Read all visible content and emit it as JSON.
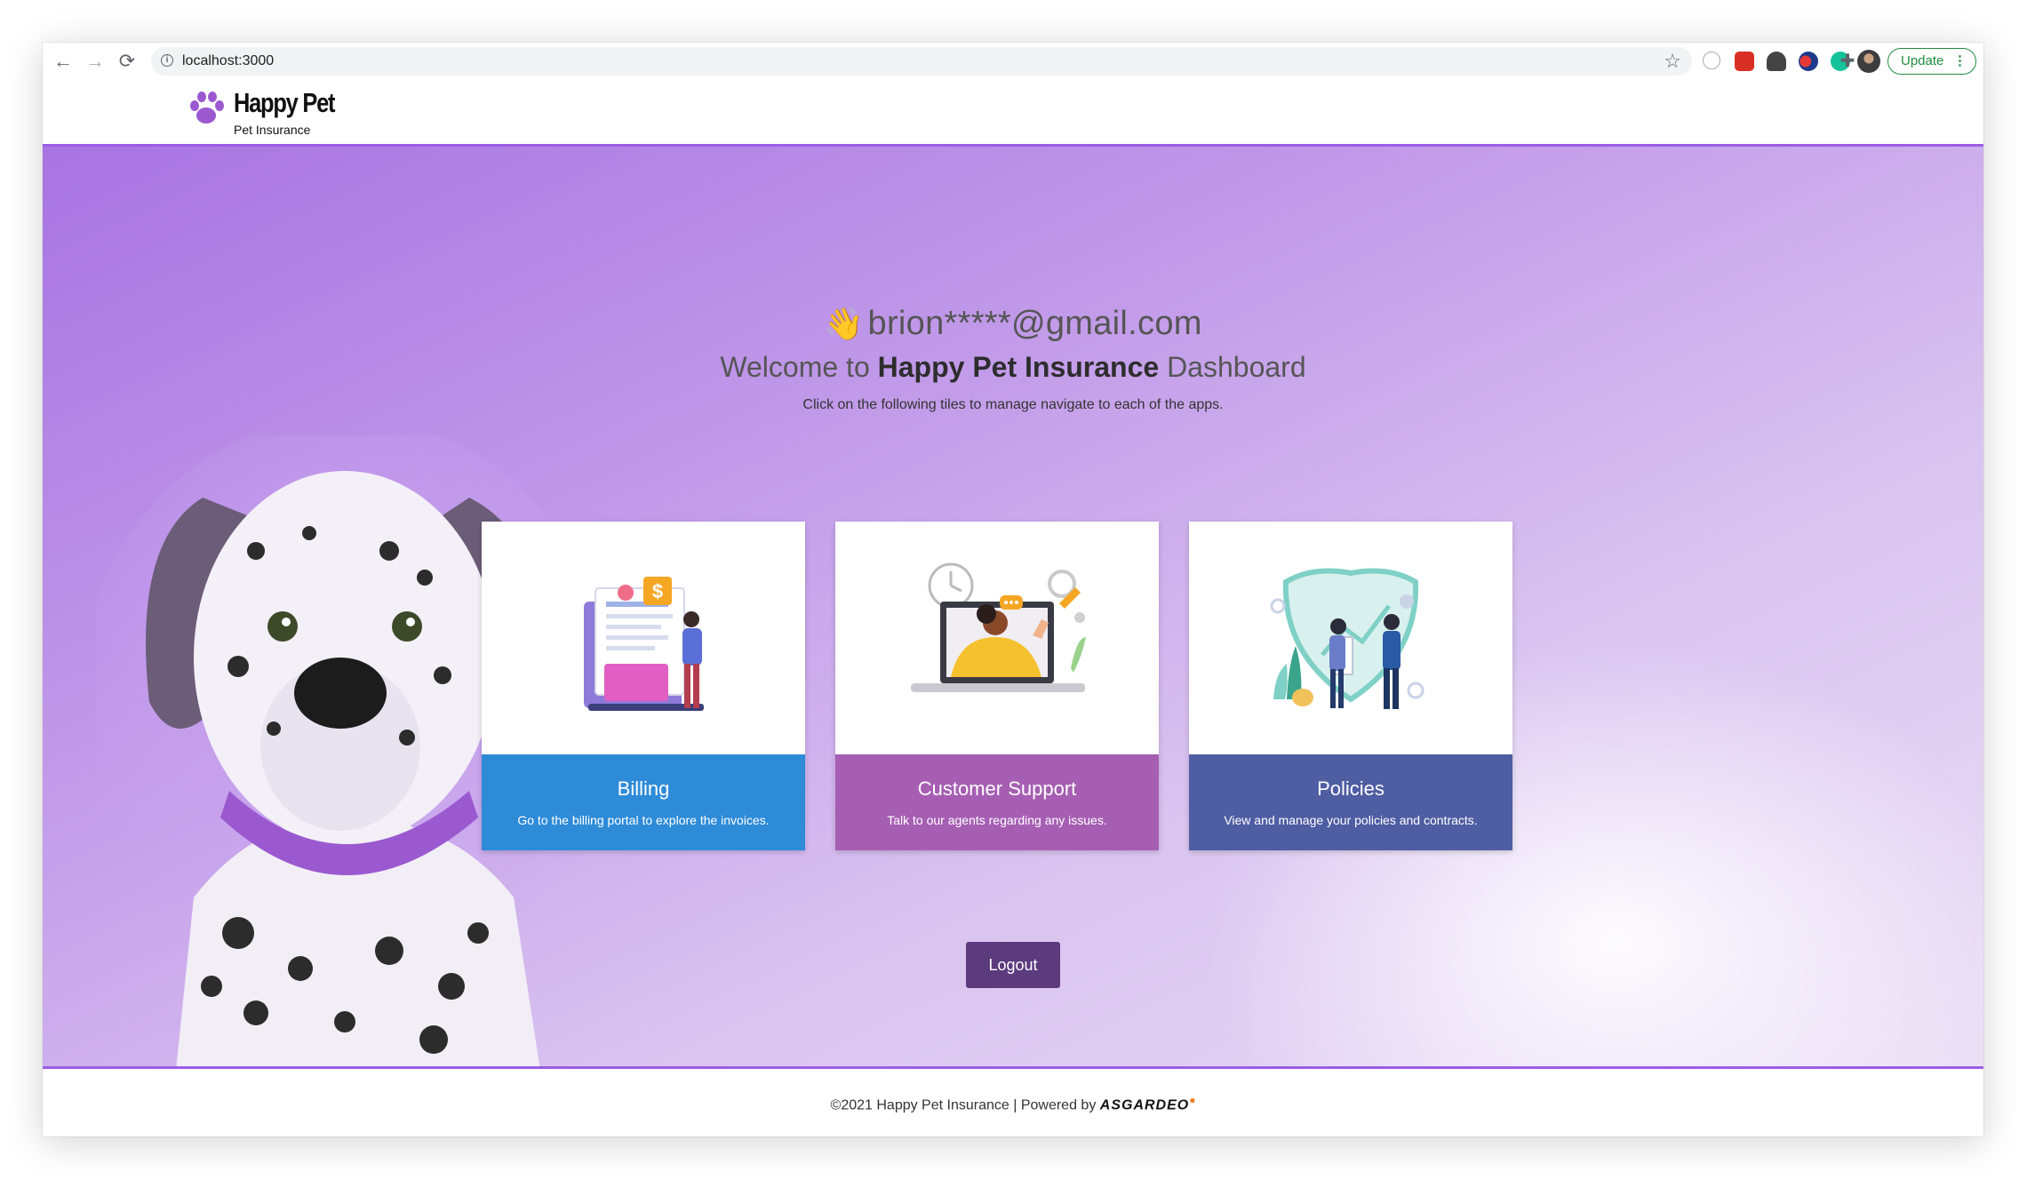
{
  "browser": {
    "url": "localhost:3000",
    "update_label": "Update",
    "update_menu": "⋮",
    "icons": [
      "back-arrow-icon",
      "forward-arrow-icon",
      "reload-icon",
      "info-icon",
      "bookmark-star-icon",
      "extension-icons",
      "puzzle-icon",
      "profile-avatar"
    ]
  },
  "header": {
    "brand": "Happy Pet",
    "brand_sub": "Pet Insurance"
  },
  "hero": {
    "wave": "👋",
    "email": "brion*****@gmail.com",
    "welcome_prefix": "Welcome to ",
    "welcome_strong": "Happy Pet Insurance",
    "welcome_suffix": " Dashboard",
    "subline": "Click on the following tiles to manage navigate to each of the apps."
  },
  "tiles": [
    {
      "title": "Billing",
      "description": "Go to the billing portal to explore the invoices.",
      "color": "#2d8bd8"
    },
    {
      "title": "Customer Support",
      "description": "Talk to our agents regarding any issues.",
      "color": "#a65eb3"
    },
    {
      "title": "Policies",
      "description": "View and manage your policies and contracts.",
      "color": "#4f5da3"
    }
  ],
  "logout_label": "Logout",
  "footer": {
    "text": "©2021 Happy Pet Insurance | Powered by ",
    "brand": "ASGARDEO"
  },
  "colors": {
    "accent": "#9b5de5",
    "logout": "#5b3a7e"
  }
}
